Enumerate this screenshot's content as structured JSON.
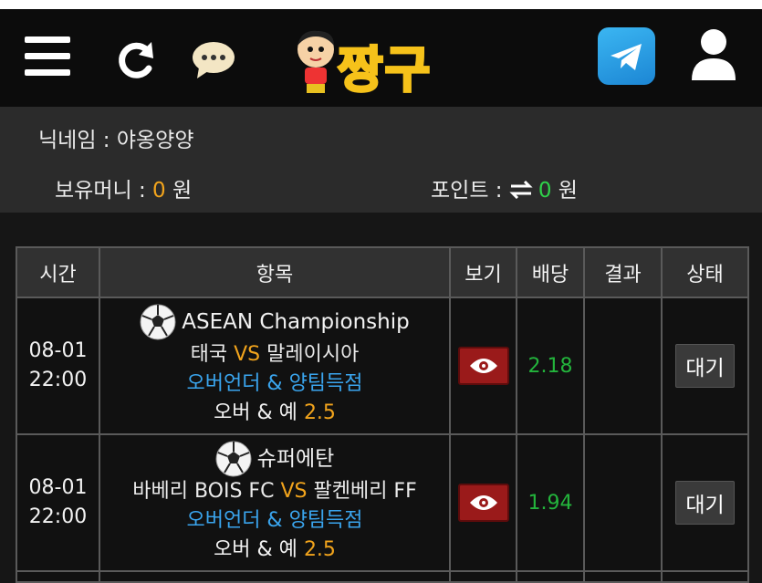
{
  "header": {
    "logo_text": "짱구",
    "icons": [
      "menu-icon",
      "refresh-icon",
      "chat-icon",
      "telegram-icon",
      "user-icon"
    ]
  },
  "account": {
    "nickname_label": "닉네임 : 야옹양양",
    "money_label": "보유머니 : ",
    "money_value": "0",
    "money_unit": " 원",
    "points_label": "포인트 : ",
    "points_value": "0",
    "points_unit": " 원"
  },
  "table": {
    "headers": [
      "시간",
      "항목",
      "보기",
      "배당",
      "결과",
      "상태"
    ],
    "rows": [
      {
        "date": "08-01",
        "time": "22:00",
        "league": "ASEAN Championship",
        "home": "태국",
        "vs": "VS",
        "away": "말레이시아",
        "bet_type": "오버언더 & 양팀득점",
        "pick_label": "오버 & 예",
        "pick_value": "2.5",
        "odds": "2.18",
        "result": "",
        "status": "대기"
      },
      {
        "date": "08-01",
        "time": "22:00",
        "league": "슈퍼에탄",
        "home": "바베리 BOIS FC",
        "vs": "VS",
        "away": "팔켄베리 FF",
        "bet_type": "오버언더 & 양팀득점",
        "pick_label": "오버 & 예",
        "pick_value": "2.5",
        "odds": "1.94",
        "result": "",
        "status": "대기"
      }
    ]
  },
  "colors": {
    "accent_orange": "#f2a41c",
    "odds_green": "#23b43c",
    "link_blue": "#3aa5ee",
    "view_button_red": "#9a1a1a"
  }
}
